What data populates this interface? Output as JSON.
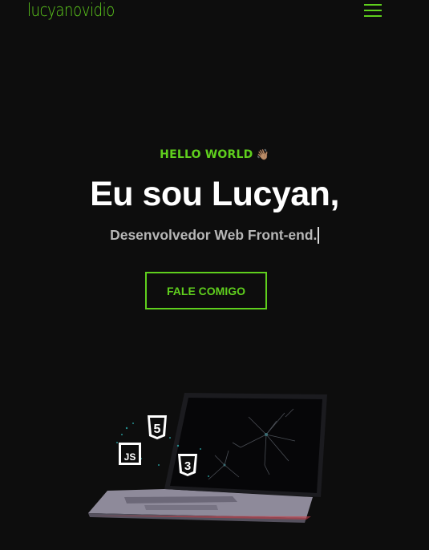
{
  "header": {
    "logo": "lucyanovidio",
    "menu_icon": "hamburger-menu-icon"
  },
  "hero": {
    "greeting": "HELLO WORLD",
    "greeting_icon": "👋🏽",
    "title": "Eu sou Lucyan,",
    "subtitle": "Desenvolvedor Web Front-end.",
    "cta_label": "FALE COMIGO"
  },
  "illustration": {
    "badges": [
      "5",
      "JS",
      "3"
    ],
    "icons": [
      "html5-icon",
      "javascript-icon",
      "css3-icon",
      "laptop-icon"
    ]
  },
  "colors": {
    "accent": "#5fcf1d",
    "background": "#0d0d0d",
    "text": "#ffffff",
    "subtitle": "#b7b7b7"
  }
}
